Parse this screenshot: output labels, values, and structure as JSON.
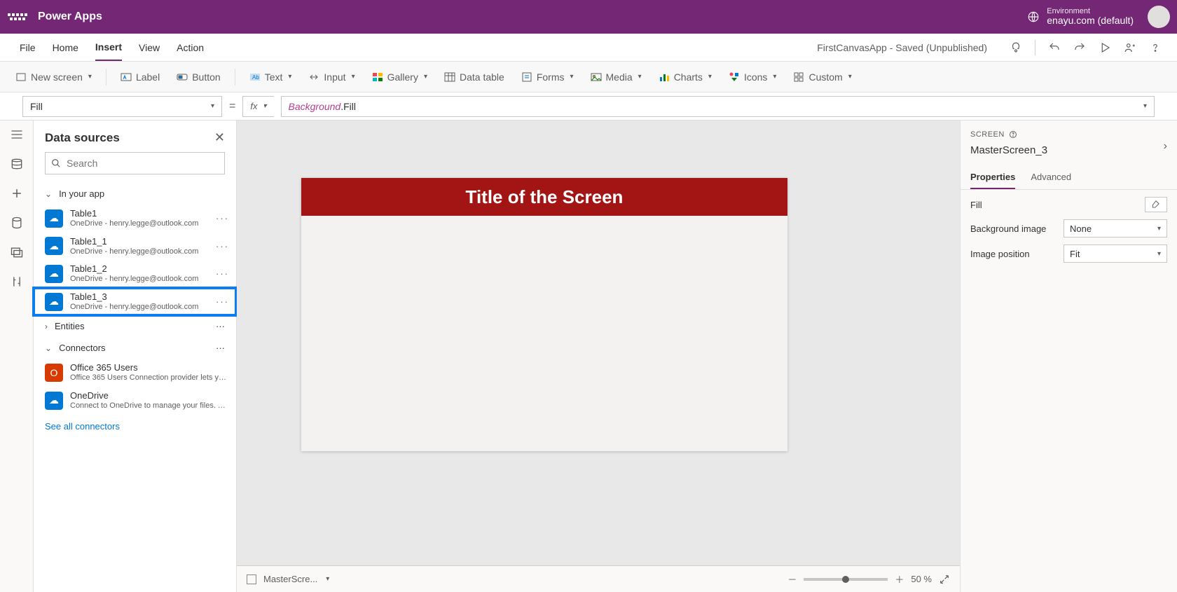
{
  "topbar": {
    "app_name": "Power Apps",
    "environment_label": "Environment",
    "environment_value": "enayu.com (default)"
  },
  "menubar": {
    "items": [
      "File",
      "Home",
      "Insert",
      "View",
      "Action"
    ],
    "active_index": 2,
    "app_status": "FirstCanvasApp - Saved (Unpublished)"
  },
  "ribbon": {
    "new_screen": "New screen",
    "label": "Label",
    "button": "Button",
    "text": "Text",
    "input": "Input",
    "gallery": "Gallery",
    "data_table": "Data table",
    "forms": "Forms",
    "media": "Media",
    "charts": "Charts",
    "icons": "Icons",
    "custom": "Custom"
  },
  "formula": {
    "property": "Fill",
    "fx_label": "fx",
    "object": "Background",
    "prop": ".Fill"
  },
  "datapanel": {
    "title": "Data sources",
    "search_placeholder": "Search",
    "section_in_app": "In your app",
    "items": [
      {
        "name": "Table1",
        "sub": "OneDrive - henry.legge@outlook.com"
      },
      {
        "name": "Table1_1",
        "sub": "OneDrive - henry.legge@outlook.com"
      },
      {
        "name": "Table1_2",
        "sub": "OneDrive - henry.legge@outlook.com"
      },
      {
        "name": "Table1_3",
        "sub": "OneDrive - henry.legge@outlook.com"
      }
    ],
    "highlight_index": 3,
    "section_entities": "Entities",
    "section_connectors": "Connectors",
    "connectors": [
      {
        "name": "Office 365 Users",
        "sub": "Office 365 Users Connection provider lets you ...",
        "color": "orange"
      },
      {
        "name": "OneDrive",
        "sub": "Connect to OneDrive to manage your files. Yo...",
        "color": "blue"
      }
    ],
    "see_all": "See all connectors"
  },
  "canvas": {
    "screen_title": "Title of the Screen",
    "footer_name": "MasterScre...",
    "zoom": "50 %"
  },
  "props": {
    "label": "SCREEN",
    "name": "MasterScreen_3",
    "tabs": [
      "Properties",
      "Advanced"
    ],
    "active_tab": 0,
    "fill_label": "Fill",
    "bg_image_label": "Background image",
    "bg_image_value": "None",
    "img_pos_label": "Image position",
    "img_pos_value": "Fit"
  }
}
